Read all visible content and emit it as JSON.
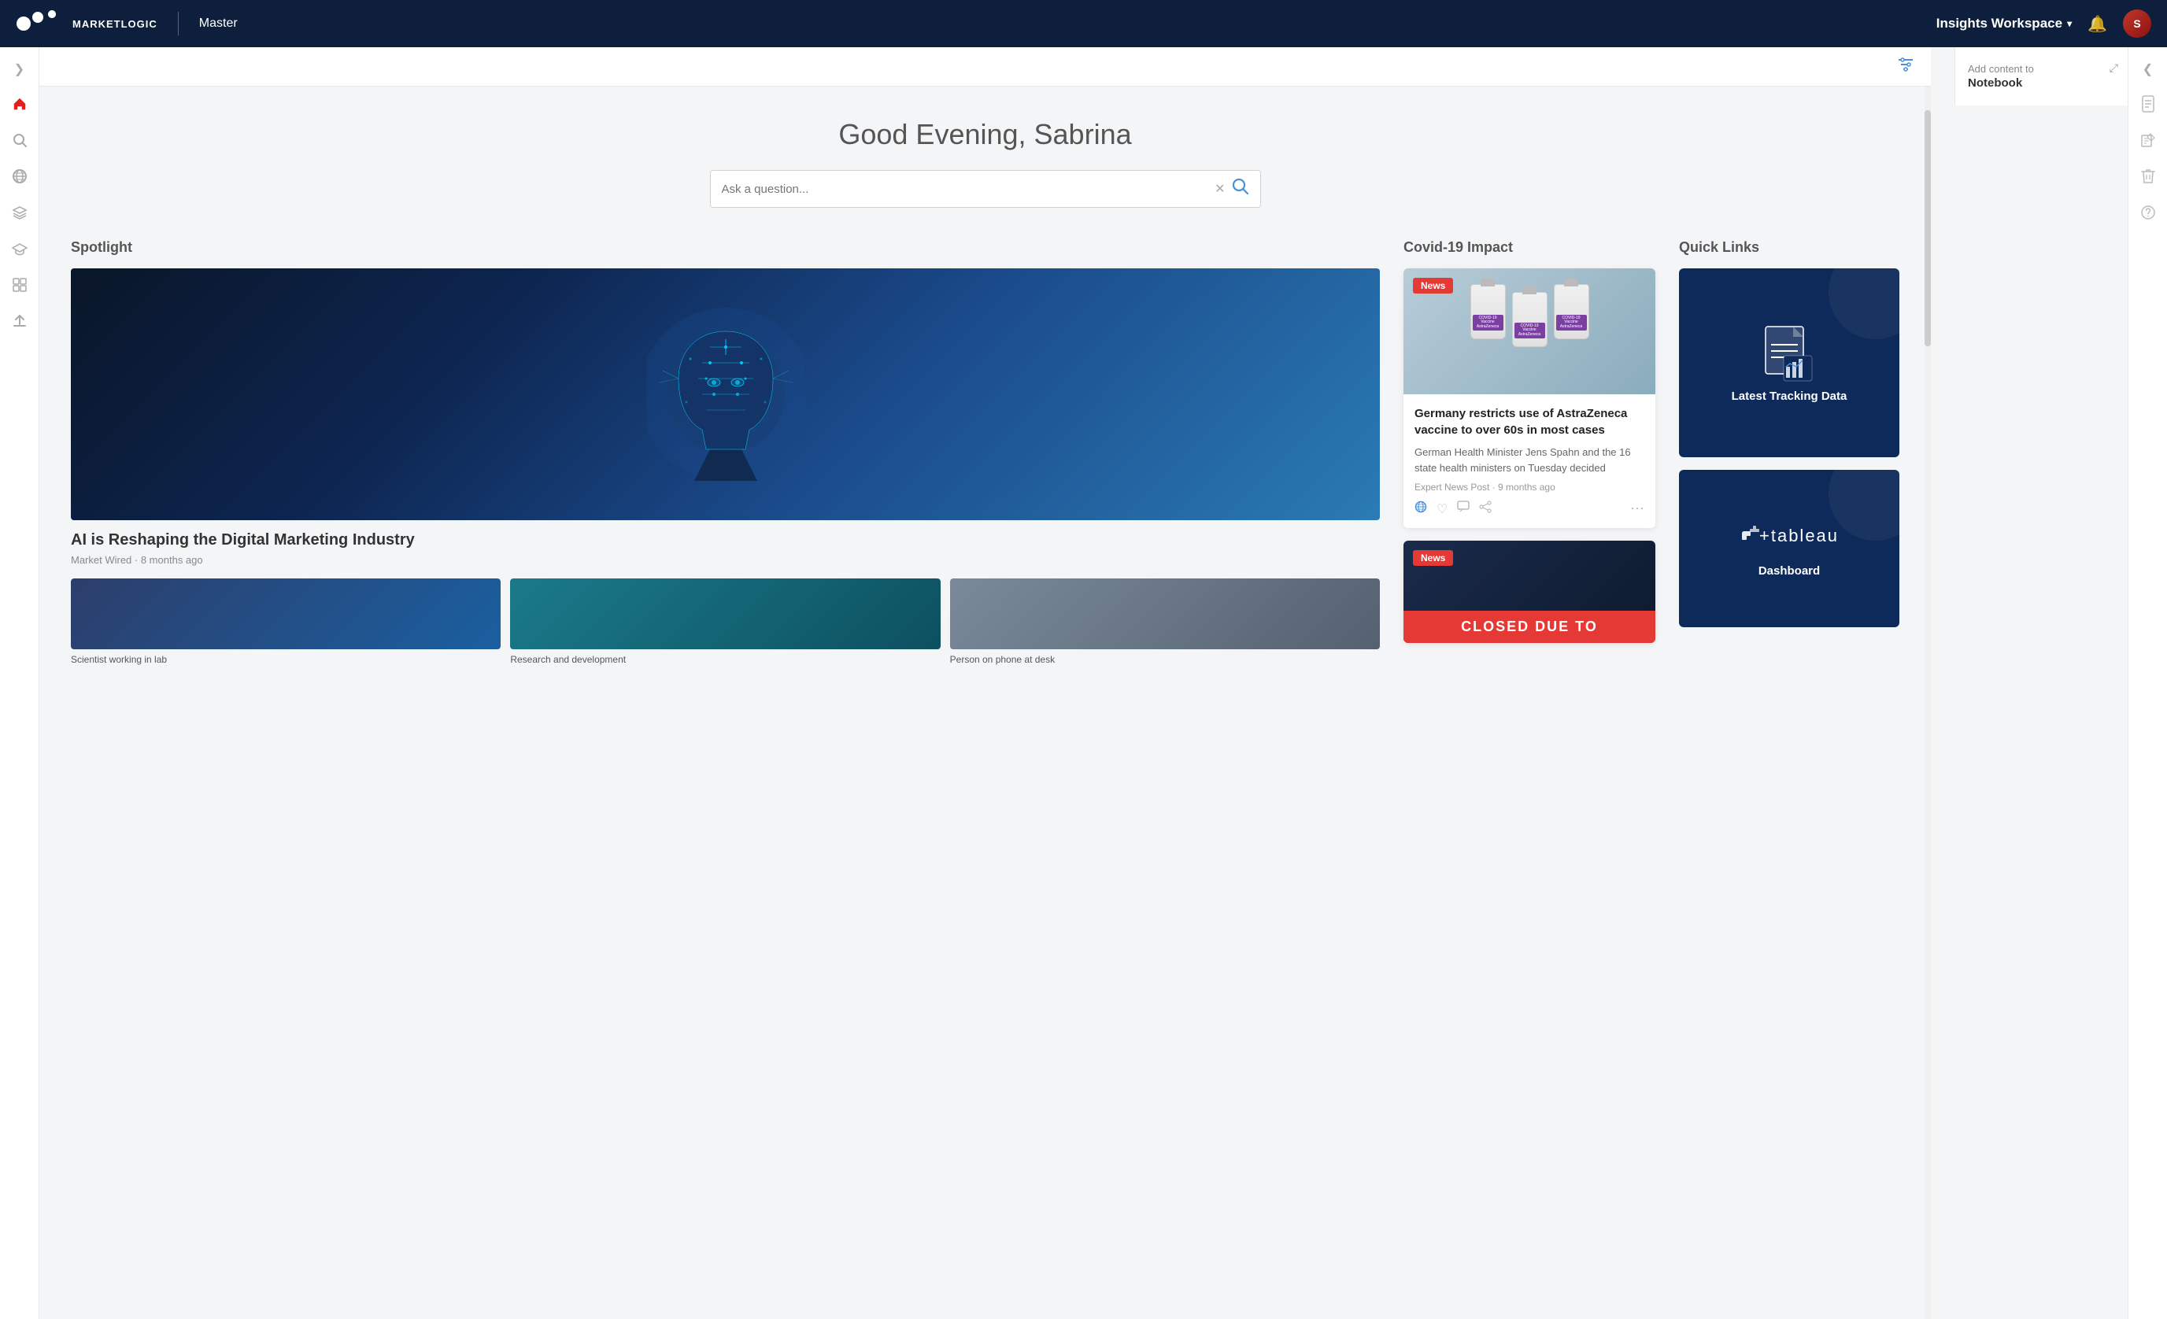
{
  "topnav": {
    "logo_text": "MARKETLOGIC",
    "product_name": "Master",
    "workspace_label": "Insights Workspace",
    "workspace_chevron": "▾",
    "notification_icon": "🔔",
    "avatar_initials": "S"
  },
  "filter_bar": {
    "filter_icon_label": "⊞"
  },
  "notebook_panel": {
    "title": "Add content to",
    "subtitle": "Notebook",
    "expand_icon": "⤢"
  },
  "main": {
    "greeting": "Good Evening, Sabrina",
    "search_placeholder": "Ask a question...",
    "clear_icon": "✕",
    "search_icon": "🔍"
  },
  "spotlight": {
    "section_title": "Spotlight",
    "main_title": "AI is Reshaping the Digital Marketing Industry",
    "main_meta": "Market Wired · 8 months ago",
    "thumbnails": [
      {
        "label": "Scientist working in lab",
        "color": "blue"
      },
      {
        "label": "Research and development",
        "color": "teal"
      },
      {
        "label": "Person on phone at desk",
        "color": "gray"
      }
    ]
  },
  "covid": {
    "section_title": "Covid-19 Impact",
    "card1": {
      "badge": "News",
      "title": "Germany restricts use of AstraZeneca vaccine to over 60s in most cases",
      "description": "German Health Minister Jens Spahn and the 16 state health ministers on Tuesday decided",
      "meta": "Expert News Post · 9 months ago",
      "actions": [
        "🌐",
        "♡",
        "💬",
        "⤴",
        "⋮"
      ]
    },
    "card2": {
      "badge": "News",
      "closed_text": "CLOSED DUE TO"
    }
  },
  "quicklinks": {
    "section_title": "Quick Links",
    "cards": [
      {
        "label": "Latest Tracking Data",
        "type": "document"
      },
      {
        "label": "Dashboard",
        "type": "tableau"
      }
    ]
  },
  "right_sidebar_icons": [
    "📄",
    "📋",
    "🗑️",
    "❓"
  ],
  "left_sidebar_icons": [
    {
      "name": "home-icon",
      "icon": "⌂",
      "active": true
    },
    {
      "name": "search-icon",
      "icon": "🔍",
      "active": false
    },
    {
      "name": "globe-icon",
      "icon": "🌐",
      "active": false
    },
    {
      "name": "layers-icon",
      "icon": "⧉",
      "active": false
    },
    {
      "name": "graduation-icon",
      "icon": "🎓",
      "active": false
    },
    {
      "name": "grid-icon",
      "icon": "⊞",
      "active": false
    },
    {
      "name": "upload-icon",
      "icon": "⬆",
      "active": false
    }
  ]
}
